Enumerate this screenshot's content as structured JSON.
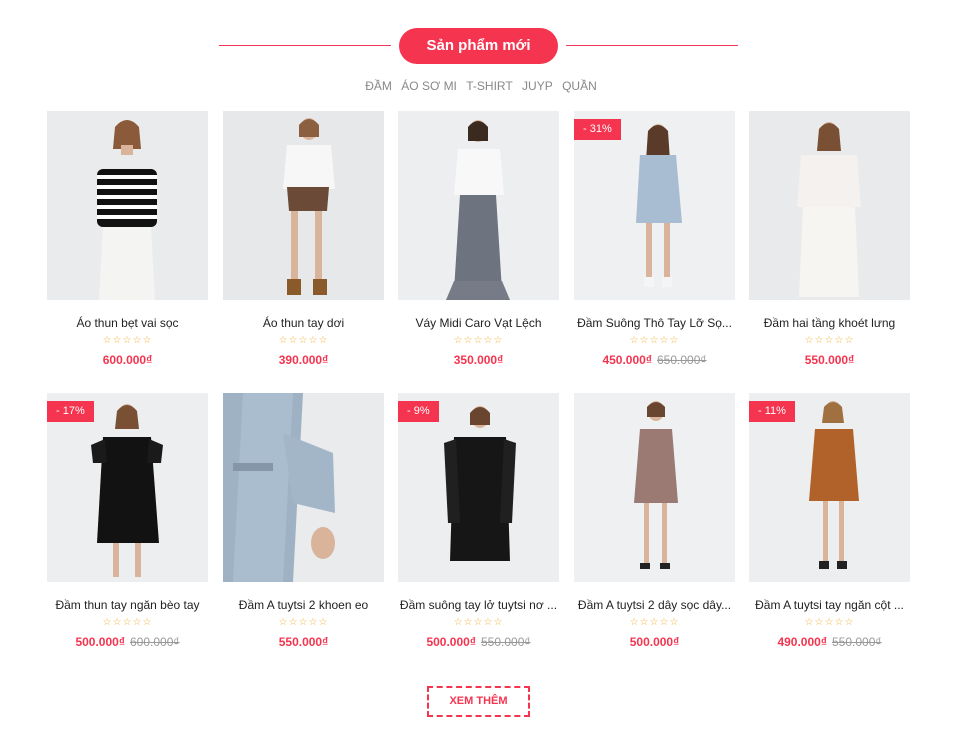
{
  "section": {
    "title": "Sản phẩm mới"
  },
  "tabs": [
    "ĐẦM",
    "ÁO SƠ MI",
    "T-SHIRT",
    "JUYP",
    "QUẦN"
  ],
  "products": [
    {
      "name": "Áo thun bẹt vai sọc",
      "stars": "☆☆☆☆☆",
      "price": "600.000₫",
      "old_price": "",
      "badge": ""
    },
    {
      "name": "Áo thun tay dơi",
      "stars": "☆☆☆☆☆",
      "price": "390.000₫",
      "old_price": "",
      "badge": ""
    },
    {
      "name": "Váy Midi Caro Vạt Lệch",
      "stars": "☆☆☆☆☆",
      "price": "350.000₫",
      "old_price": "",
      "badge": ""
    },
    {
      "name": "Đầm Suông Thô Tay Lỡ Sọ...",
      "stars": "☆☆☆☆☆",
      "price": "450.000₫",
      "old_price": "650.000₫",
      "badge": "- 31%"
    },
    {
      "name": "Đầm hai tầng khoét lưng",
      "stars": "☆☆☆☆☆",
      "price": "550.000₫",
      "old_price": "",
      "badge": ""
    },
    {
      "name": "Đầm thun tay ngăn bèo tay",
      "stars": "☆☆☆☆☆",
      "price": "500.000₫",
      "old_price": "600.000₫",
      "badge": "- 17%"
    },
    {
      "name": "Đầm A tuytsi 2 khoen eo",
      "stars": "☆☆☆☆☆",
      "price": "550.000₫",
      "old_price": "",
      "badge": ""
    },
    {
      "name": "Đầm suông tay lở tuytsi nơ ...",
      "stars": "☆☆☆☆☆",
      "price": "500.000₫",
      "old_price": "550.000₫",
      "badge": "- 9%"
    },
    {
      "name": "Đầm A tuytsi 2 dây sọc dây...",
      "stars": "☆☆☆☆☆",
      "price": "500.000₫",
      "old_price": "",
      "badge": ""
    },
    {
      "name": "Đầm A tuytsi tay ngăn cột ...",
      "stars": "☆☆☆☆☆",
      "price": "490.000₫",
      "old_price": "550.000₫",
      "badge": "- 11%"
    }
  ],
  "more_button": "XEM THÊM",
  "colors": {
    "accent": "#f5344f",
    "star": "#f3b33d"
  }
}
